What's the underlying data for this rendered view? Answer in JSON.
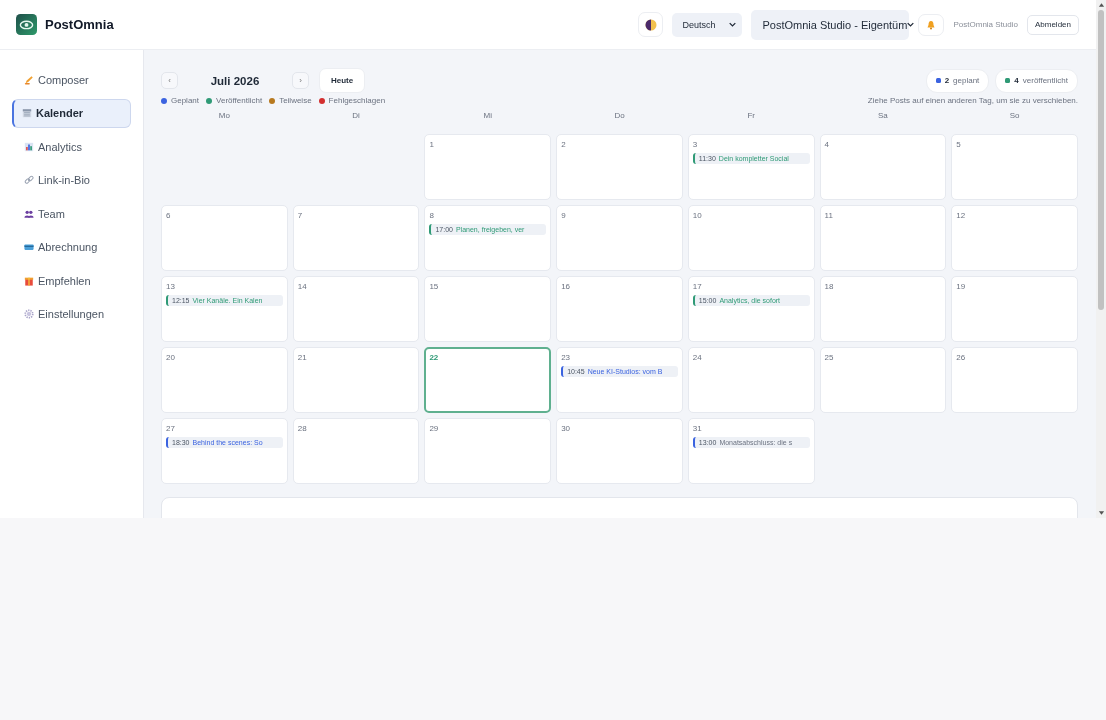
{
  "header": {
    "brand": "PostOmnia",
    "language": "Deutsch",
    "workspace": "PostOmnia Studio - Eigentüm",
    "account": "PostOmnia Studio",
    "logout": "Abmelden"
  },
  "sidebar": {
    "items": [
      {
        "label": "Composer",
        "selected": false
      },
      {
        "label": "Kalender",
        "selected": true
      },
      {
        "label": "Analytics",
        "selected": false
      },
      {
        "label": "Link-in-Bio",
        "selected": false
      },
      {
        "label": "Team",
        "selected": false
      },
      {
        "label": "Abrechnung",
        "selected": false
      },
      {
        "label": "Empfehlen",
        "selected": false
      },
      {
        "label": "Einstellungen",
        "selected": false
      }
    ]
  },
  "toolbar": {
    "prev": "‹",
    "month": "Juli 2026",
    "next": "›",
    "today_button": "Heute"
  },
  "summary": [
    {
      "count": "2",
      "label": "geplant",
      "color": "#3b63e0"
    },
    {
      "count": "4",
      "label": "veröffentlicht",
      "color": "#2f9a76"
    }
  ],
  "legend": [
    {
      "label": "Geplant",
      "color": "#3b63e0"
    },
    {
      "label": "Veröffentlicht",
      "color": "#2f9a76"
    },
    {
      "label": "Teilweise",
      "color": "#b7791f"
    },
    {
      "label": "Fehlgeschlagen",
      "color": "#d32f2f"
    }
  ],
  "hint": "Ziehe Posts auf einen anderen Tag, um sie zu verschieben.",
  "weekdays": [
    "Mo",
    "Di",
    "Mi",
    "Do",
    "Fr",
    "Sa",
    "So"
  ],
  "days": [
    {
      "kind": "blank"
    },
    {
      "kind": "blank"
    },
    {
      "kind": "day",
      "day": "1",
      "today": false
    },
    {
      "kind": "day",
      "day": "2",
      "today": false
    },
    {
      "kind": "day",
      "day": "3",
      "today": false,
      "posts": [
        {
          "time": "11:30",
          "title": "Dein kompletter Social",
          "kind": "published"
        }
      ]
    },
    {
      "kind": "day",
      "day": "4",
      "today": false
    },
    {
      "kind": "day",
      "day": "5",
      "today": false
    },
    {
      "kind": "day",
      "day": "6",
      "today": false
    },
    {
      "kind": "day",
      "day": "7",
      "today": false
    },
    {
      "kind": "day",
      "day": "8",
      "today": false,
      "posts": [
        {
          "time": "17:00",
          "title": "Planen, freigeben, ver",
          "kind": "published"
        }
      ]
    },
    {
      "kind": "day",
      "day": "9",
      "today": false
    },
    {
      "kind": "day",
      "day": "10",
      "today": false
    },
    {
      "kind": "day",
      "day": "11",
      "today": false
    },
    {
      "kind": "day",
      "day": "12",
      "today": false
    },
    {
      "kind": "day",
      "day": "13",
      "today": false,
      "posts": [
        {
          "time": "12:15",
          "title": "Vier Kanäle. Ein Kalen",
          "kind": "published"
        }
      ]
    },
    {
      "kind": "day",
      "day": "14",
      "today": false
    },
    {
      "kind": "day",
      "day": "15",
      "today": false
    },
    {
      "kind": "day",
      "day": "16",
      "today": false
    },
    {
      "kind": "day",
      "day": "17",
      "today": false,
      "posts": [
        {
          "time": "15:00",
          "title": "Analytics, die sofort",
          "kind": "published"
        }
      ]
    },
    {
      "kind": "day",
      "day": "18",
      "today": false
    },
    {
      "kind": "day",
      "day": "19",
      "today": false
    },
    {
      "kind": "day",
      "day": "20",
      "today": false
    },
    {
      "kind": "day",
      "day": "21",
      "today": false
    },
    {
      "kind": "day",
      "day": "22",
      "today": true
    },
    {
      "kind": "day",
      "day": "23",
      "today": false,
      "posts": [
        {
          "time": "10:45",
          "title": "Neue KI-Studios: vom B",
          "kind": "planned"
        }
      ]
    },
    {
      "kind": "day",
      "day": "24",
      "today": false
    },
    {
      "kind": "day",
      "day": "25",
      "today": false
    },
    {
      "kind": "day",
      "day": "26",
      "today": false
    },
    {
      "kind": "day",
      "day": "27",
      "today": false,
      "posts": [
        {
          "time": "18:30",
          "title": "Behind the scenes: So",
          "kind": "planned"
        }
      ]
    },
    {
      "kind": "day",
      "day": "28",
      "today": false
    },
    {
      "kind": "day",
      "day": "29",
      "today": false
    },
    {
      "kind": "day",
      "day": "30",
      "today": false
    },
    {
      "kind": "day",
      "day": "31",
      "today": false,
      "posts": [
        {
          "time": "13:00",
          "title": "Monatsabschluss: die s",
          "kind": "draft"
        }
      ]
    }
  ]
}
